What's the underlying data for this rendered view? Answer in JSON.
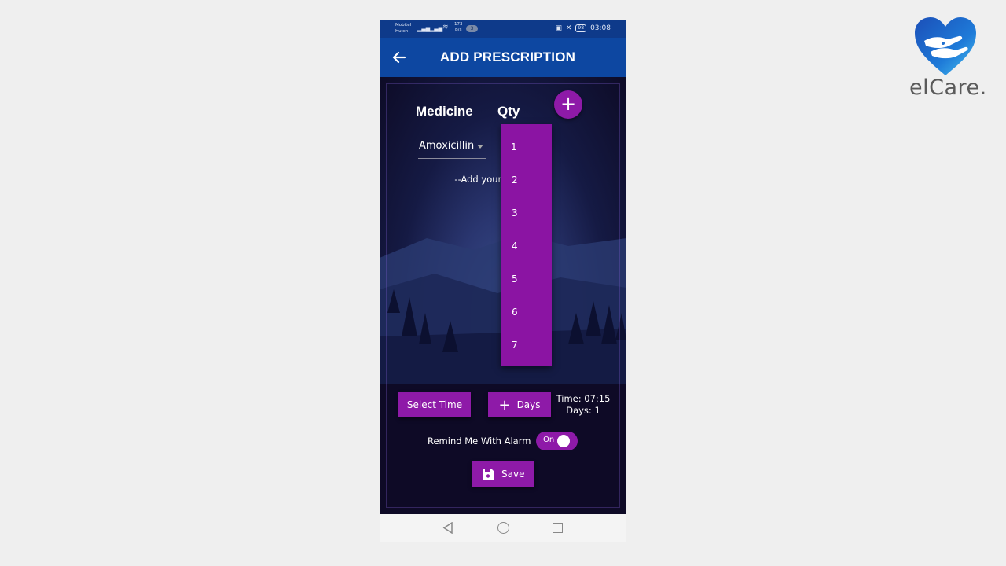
{
  "brand": {
    "name": "elCare.",
    "colors": {
      "heart": "#1e6fd0",
      "text": "#5a5a5a"
    }
  },
  "status_bar": {
    "carrier_line1": "Mobitel",
    "carrier_line2": "Hutch",
    "speed_value": "173",
    "speed_unit": "B/s",
    "notification_count": "3",
    "battery": "98",
    "time": "03:08"
  },
  "app_bar": {
    "title": "ADD PRESCRIPTION",
    "back_icon": "arrow-left-icon"
  },
  "form": {
    "medicine_header": "Medicine",
    "qty_header": "Qty",
    "add_icon": "plus-icon",
    "medicine_value": "Amoxicillin",
    "add_hint": "--Add your Medicine--",
    "qty_options": [
      "1",
      "2",
      "3",
      "4",
      "5",
      "6",
      "7"
    ],
    "select_time_label": "Select Time",
    "days_button_label": "Days",
    "time_info": "Time: 07:15",
    "days_info": "Days: 1",
    "remind_label": "Remind Me With Alarm",
    "toggle_label": "On",
    "toggle_state": true,
    "save_label": "Save"
  },
  "colors": {
    "accent": "#8e1aa8",
    "app_bar": "#0d47a1",
    "status_bar": "#0e3a8a"
  }
}
